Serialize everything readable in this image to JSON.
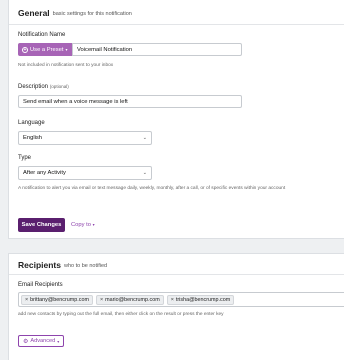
{
  "general": {
    "title": "General",
    "subtitle": "basic settings for this notification",
    "name": {
      "label": "Notification Name",
      "preset_button": "Use a Preset",
      "value": "Voicemail Notification",
      "help": "Not included in notification sent to your inbox"
    },
    "description": {
      "label": "Description",
      "optional": "(optional)",
      "value": "Send email when a voice message is left"
    },
    "language": {
      "label": "Language",
      "selected": "English"
    },
    "type": {
      "label": "Type",
      "selected": "After any Activity",
      "help": "A notification to alert you via email or text message daily, weekly, monthly, after a call, or of specific events within your account"
    },
    "save_button": "Save Changes",
    "copy_link": "Copy to"
  },
  "recipients": {
    "title": "Recipients",
    "subtitle": "who to be notified",
    "email_label": "Email Recipients",
    "emails": [
      "brittany@bencrump.com",
      "mario@bencrump.com",
      "trisha@bencrump.com"
    ],
    "help": "add new contacts by typing out the full email, then either click on the result or press the enter key",
    "advanced_button": "Advanced"
  },
  "colors": {
    "accent": "#8e44ad",
    "preset_button": "#a764b6",
    "save_button": "#5a1f6e"
  }
}
